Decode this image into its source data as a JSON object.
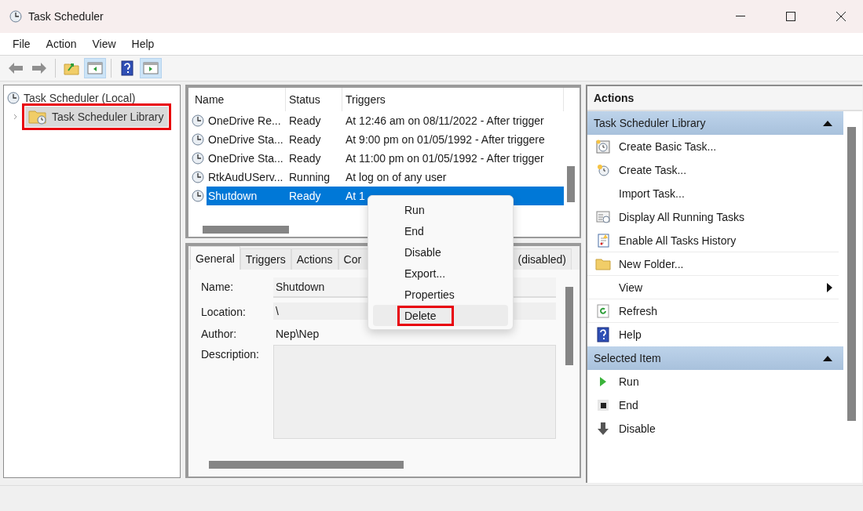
{
  "window": {
    "title": "Task Scheduler"
  },
  "menu": [
    "File",
    "Action",
    "View",
    "Help"
  ],
  "toolbar": [
    {
      "kind": "back",
      "pressed": false
    },
    {
      "kind": "forward",
      "pressed": false
    },
    {
      "kind": "up",
      "pressed": false
    },
    {
      "kind": "tree",
      "pressed": true
    },
    {
      "kind": "help",
      "pressed": false
    },
    {
      "kind": "actions",
      "pressed": true
    }
  ],
  "tree": {
    "root": "Task Scheduler (Local)",
    "children": [
      {
        "label": "Task Scheduler Library",
        "selected": true,
        "highlighted": true
      }
    ]
  },
  "task_list": {
    "columns": [
      "Name",
      "Status",
      "Triggers"
    ],
    "rows": [
      {
        "name": "OneDrive Re...",
        "status": "Ready",
        "trigger": "At 12:46 am on 08/11/2022 - After trigger",
        "selected": false
      },
      {
        "name": "OneDrive Sta...",
        "status": "Ready",
        "trigger": "At 9:00 pm on 01/05/1992 - After triggere",
        "selected": false
      },
      {
        "name": "OneDrive Sta...",
        "status": "Ready",
        "trigger": "At 11:00 pm on 01/05/1992 - After trigger",
        "selected": false
      },
      {
        "name": "RtkAudUServ...",
        "status": "Running",
        "trigger": "At log on of any user",
        "selected": false
      },
      {
        "name": "Shutdown",
        "status": "Ready",
        "trigger": "At 1",
        "selected": true
      }
    ]
  },
  "context_menu": {
    "items": [
      {
        "label": "Run",
        "hovered": false,
        "highlighted": false
      },
      {
        "label": "End",
        "hovered": false,
        "highlighted": false
      },
      {
        "label": "Disable",
        "hovered": false,
        "highlighted": false
      },
      {
        "label": "Export...",
        "hovered": false,
        "highlighted": false
      },
      {
        "label": "Properties",
        "hovered": false,
        "highlighted": false
      },
      {
        "label": "Delete",
        "hovered": true,
        "highlighted": true
      }
    ]
  },
  "details": {
    "tabs": [
      {
        "label": "General",
        "selected": true
      },
      {
        "label": "Triggers",
        "selected": false
      },
      {
        "label": "Actions",
        "selected": false
      },
      {
        "label": "Cor",
        "selected": false
      },
      {
        "label": "(disabled)",
        "selected": false
      }
    ],
    "fields": [
      {
        "kind": "field",
        "label": "Name:",
        "value": "Shutdown"
      },
      {
        "kind": "shaded",
        "label": "Location:",
        "value": "\\"
      },
      {
        "kind": "plain",
        "label": "Author:",
        "value": "Nep\\Nep"
      },
      {
        "kind": "area",
        "label": "Description:"
      }
    ]
  },
  "actions": {
    "title": "Actions",
    "sections": [
      {
        "title": "Task Scheduler Library",
        "expanded": true,
        "items": [
          {
            "label": "Create Basic Task...",
            "kind": "basic",
            "submenu": false,
            "divider": false
          },
          {
            "label": "Create Task...",
            "kind": "create",
            "submenu": false,
            "divider": false
          },
          {
            "label": "Import Task...",
            "kind": "plain",
            "submenu": false,
            "divider": false
          },
          {
            "label": "Display All Running Tasks",
            "kind": "running",
            "submenu": false,
            "divider": false
          },
          {
            "label": "Enable All Tasks History",
            "kind": "history",
            "submenu": false,
            "divider": true
          },
          {
            "label": "New Folder...",
            "kind": "folder",
            "submenu": false,
            "divider": true
          },
          {
            "label": "View",
            "kind": "plain",
            "submenu": true,
            "divider": true
          },
          {
            "label": "Refresh",
            "kind": "refresh",
            "submenu": false,
            "divider": true
          },
          {
            "label": "Help",
            "kind": "help",
            "submenu": false,
            "divider": false
          }
        ]
      },
      {
        "title": "Selected Item",
        "expanded": true,
        "items": [
          {
            "label": "Run",
            "kind": "run",
            "submenu": false,
            "divider": false
          },
          {
            "label": "End",
            "kind": "end",
            "submenu": false,
            "divider": false
          },
          {
            "label": "Disable",
            "kind": "disable",
            "submenu": false,
            "divider": false
          }
        ]
      }
    ]
  }
}
